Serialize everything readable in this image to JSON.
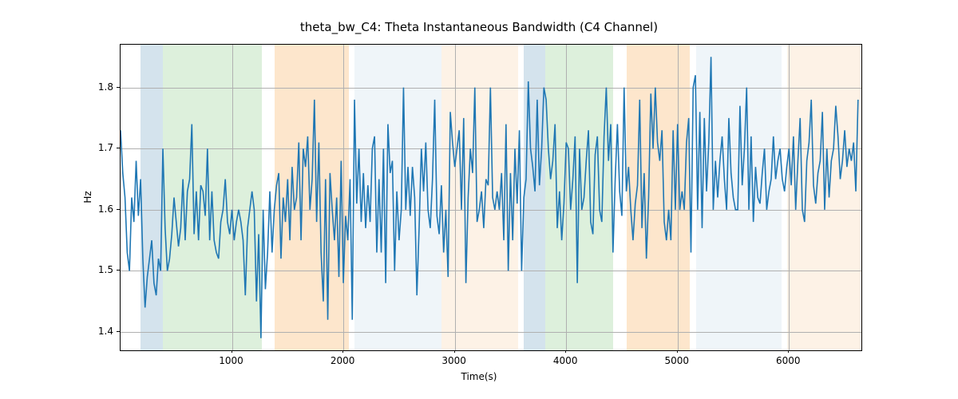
{
  "chart_data": {
    "type": "line",
    "title": "theta_bw_C4: Theta Instantaneous Bandwidth (C4 Channel)",
    "xlabel": "Time(s)",
    "ylabel": "Hz",
    "xlim": [
      0,
      6650
    ],
    "ylim": [
      1.37,
      1.87
    ],
    "xticks": [
      1000,
      2000,
      3000,
      4000,
      5000,
      6000
    ],
    "yticks": [
      1.4,
      1.5,
      1.6,
      1.7,
      1.8
    ],
    "xtick_labels": [
      "1000",
      "2000",
      "3000",
      "4000",
      "5000",
      "6000"
    ],
    "ytick_labels": [
      "1.4",
      "1.5",
      "1.6",
      "1.7",
      "1.8"
    ],
    "bands": [
      {
        "x0": 180,
        "x1": 380,
        "color": "#9fc0d8"
      },
      {
        "x0": 380,
        "x1": 1270,
        "color": "#b4deb1"
      },
      {
        "x0": 1380,
        "x1": 2050,
        "color": "#fac88e"
      },
      {
        "x0": 2100,
        "x1": 2880,
        "color": "#dce8f2"
      },
      {
        "x0": 2880,
        "x1": 3570,
        "color": "#fae2c8"
      },
      {
        "x0": 3620,
        "x1": 3810,
        "color": "#9fc0d8"
      },
      {
        "x0": 3810,
        "x1": 4420,
        "color": "#b4deb1"
      },
      {
        "x0": 4540,
        "x1": 5110,
        "color": "#fac88e"
      },
      {
        "x0": 5170,
        "x1": 5930,
        "color": "#dce8f2"
      },
      {
        "x0": 5980,
        "x1": 6650,
        "color": "#fae2c8"
      }
    ],
    "series": [
      {
        "name": "theta_bw_C4",
        "color": "#1f77b4",
        "x_step": 20,
        "y": [
          1.73,
          1.66,
          1.62,
          1.53,
          1.5,
          1.62,
          1.58,
          1.68,
          1.59,
          1.65,
          1.52,
          1.44,
          1.49,
          1.52,
          1.55,
          1.48,
          1.46,
          1.52,
          1.5,
          1.7,
          1.57,
          1.5,
          1.52,
          1.56,
          1.62,
          1.58,
          1.54,
          1.57,
          1.65,
          1.55,
          1.63,
          1.65,
          1.74,
          1.56,
          1.63,
          1.55,
          1.64,
          1.63,
          1.59,
          1.7,
          1.55,
          1.63,
          1.55,
          1.53,
          1.52,
          1.58,
          1.6,
          1.65,
          1.58,
          1.56,
          1.6,
          1.55,
          1.58,
          1.6,
          1.58,
          1.55,
          1.46,
          1.57,
          1.6,
          1.63,
          1.6,
          1.45,
          1.56,
          1.39,
          1.6,
          1.47,
          1.53,
          1.63,
          1.53,
          1.6,
          1.64,
          1.66,
          1.52,
          1.62,
          1.58,
          1.65,
          1.55,
          1.67,
          1.6,
          1.62,
          1.71,
          1.55,
          1.7,
          1.67,
          1.72,
          1.6,
          1.65,
          1.78,
          1.58,
          1.71,
          1.53,
          1.45,
          1.65,
          1.42,
          1.66,
          1.6,
          1.55,
          1.62,
          1.49,
          1.68,
          1.48,
          1.59,
          1.55,
          1.65,
          1.42,
          1.78,
          1.61,
          1.7,
          1.58,
          1.66,
          1.57,
          1.64,
          1.58,
          1.7,
          1.72,
          1.53,
          1.65,
          1.53,
          1.7,
          1.48,
          1.74,
          1.66,
          1.68,
          1.5,
          1.63,
          1.55,
          1.6,
          1.8,
          1.6,
          1.67,
          1.59,
          1.67,
          1.62,
          1.46,
          1.57,
          1.7,
          1.63,
          1.71,
          1.6,
          1.57,
          1.65,
          1.78,
          1.59,
          1.56,
          1.64,
          1.53,
          1.6,
          1.49,
          1.76,
          1.71,
          1.67,
          1.7,
          1.73,
          1.6,
          1.75,
          1.48,
          1.62,
          1.7,
          1.66,
          1.8,
          1.58,
          1.6,
          1.63,
          1.57,
          1.65,
          1.64,
          1.8,
          1.62,
          1.6,
          1.63,
          1.6,
          1.66,
          1.55,
          1.74,
          1.5,
          1.66,
          1.55,
          1.7,
          1.61,
          1.73,
          1.5,
          1.62,
          1.65,
          1.81,
          1.7,
          1.67,
          1.63,
          1.78,
          1.64,
          1.7,
          1.8,
          1.78,
          1.7,
          1.65,
          1.68,
          1.74,
          1.57,
          1.63,
          1.55,
          1.61,
          1.71,
          1.7,
          1.6,
          1.65,
          1.72,
          1.48,
          1.7,
          1.6,
          1.62,
          1.68,
          1.73,
          1.58,
          1.56,
          1.69,
          1.72,
          1.6,
          1.58,
          1.72,
          1.8,
          1.68,
          1.74,
          1.53,
          1.65,
          1.74,
          1.63,
          1.59,
          1.8,
          1.63,
          1.67,
          1.6,
          1.55,
          1.61,
          1.64,
          1.78,
          1.57,
          1.66,
          1.52,
          1.62,
          1.79,
          1.7,
          1.8,
          1.71,
          1.68,
          1.73,
          1.58,
          1.55,
          1.6,
          1.55,
          1.73,
          1.6,
          1.74,
          1.6,
          1.63,
          1.6,
          1.71,
          1.75,
          1.53,
          1.8,
          1.82,
          1.6,
          1.76,
          1.57,
          1.75,
          1.63,
          1.71,
          1.85,
          1.6,
          1.68,
          1.62,
          1.68,
          1.72,
          1.65,
          1.6,
          1.75,
          1.66,
          1.62,
          1.6,
          1.6,
          1.77,
          1.64,
          1.7,
          1.8,
          1.6,
          1.72,
          1.58,
          1.67,
          1.62,
          1.61,
          1.66,
          1.7,
          1.6,
          1.63,
          1.65,
          1.72,
          1.65,
          1.68,
          1.7,
          1.65,
          1.63,
          1.67,
          1.7,
          1.64,
          1.72,
          1.6,
          1.68,
          1.75,
          1.6,
          1.58,
          1.68,
          1.71,
          1.78,
          1.64,
          1.61,
          1.66,
          1.68,
          1.76,
          1.6,
          1.7,
          1.62,
          1.68,
          1.7,
          1.77,
          1.72,
          1.65,
          1.68,
          1.73,
          1.67,
          1.7,
          1.68,
          1.71,
          1.63,
          1.78
        ]
      }
    ]
  }
}
